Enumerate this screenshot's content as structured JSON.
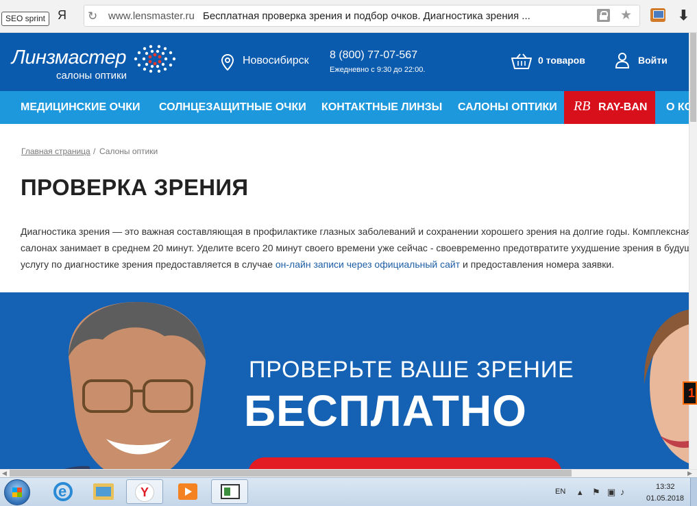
{
  "browser": {
    "seo_badge": "SEO sprint",
    "ya": "Я",
    "domain": "www.lensmaster.ru",
    "tab_title": "Бесплатная проверка зрения и подбор очков. Диагностика зрения ..."
  },
  "header": {
    "logo": "Линзмастер",
    "logo_sub": "салоны оптики",
    "city": "Новосибирск",
    "phone": "8 (800) 77-07-567",
    "hours": "Ежедневно с 9:30 до 22:00.",
    "cart": "0 товаров",
    "login": "Войти"
  },
  "nav": {
    "items": [
      "МЕДИЦИНСКИЕ ОЧКИ",
      "СОЛНЦЕЗАЩИТНЫЕ ОЧКИ",
      "КОНТАКТНЫЕ ЛИНЗЫ",
      "САЛОНЫ ОПТИКИ"
    ],
    "rayban_mark": "RB",
    "rayban": "RAY-BAN",
    "more": "О КО"
  },
  "breadcrumb": {
    "home": "Главная страница",
    "sep": "/",
    "current": "Салоны оптики"
  },
  "page": {
    "title": "ПРОВЕРКА ЗРЕНИЯ",
    "p1": "Диагностика зрения — это важная составляющая в профилактике глазных заболеваний и сохранении хорошего зрения на долгие годы. Комплексная",
    "p2": "салонах занимает в среднем 20 минут. Уделите всего 20 минут своего времени уже сейчас - своевременно предотвратите ухудшение зрения в будущ",
    "p3_start": "услугу по диагностике зрения предоставляется в случае ",
    "p3_link": "он-лайн записи через официальный сайт",
    "p3_end": " и предоставления номера заявки."
  },
  "banner": {
    "line1": "ПРОВЕРЬТЕ ВАШЕ ЗРЕНИЕ",
    "line2": "БЕСПЛАТНО"
  },
  "side_widget": "1",
  "taskbar": {
    "yandex_letter": "Y",
    "lang": "EN",
    "time": "13:32",
    "date": "01.05.2018"
  },
  "colors": {
    "header_blue": "#0a5aad",
    "nav_blue": "#1e98dc",
    "rayban_red": "#d8101c",
    "banner_blue": "#1562b4",
    "cta_red": "#e31b23"
  }
}
